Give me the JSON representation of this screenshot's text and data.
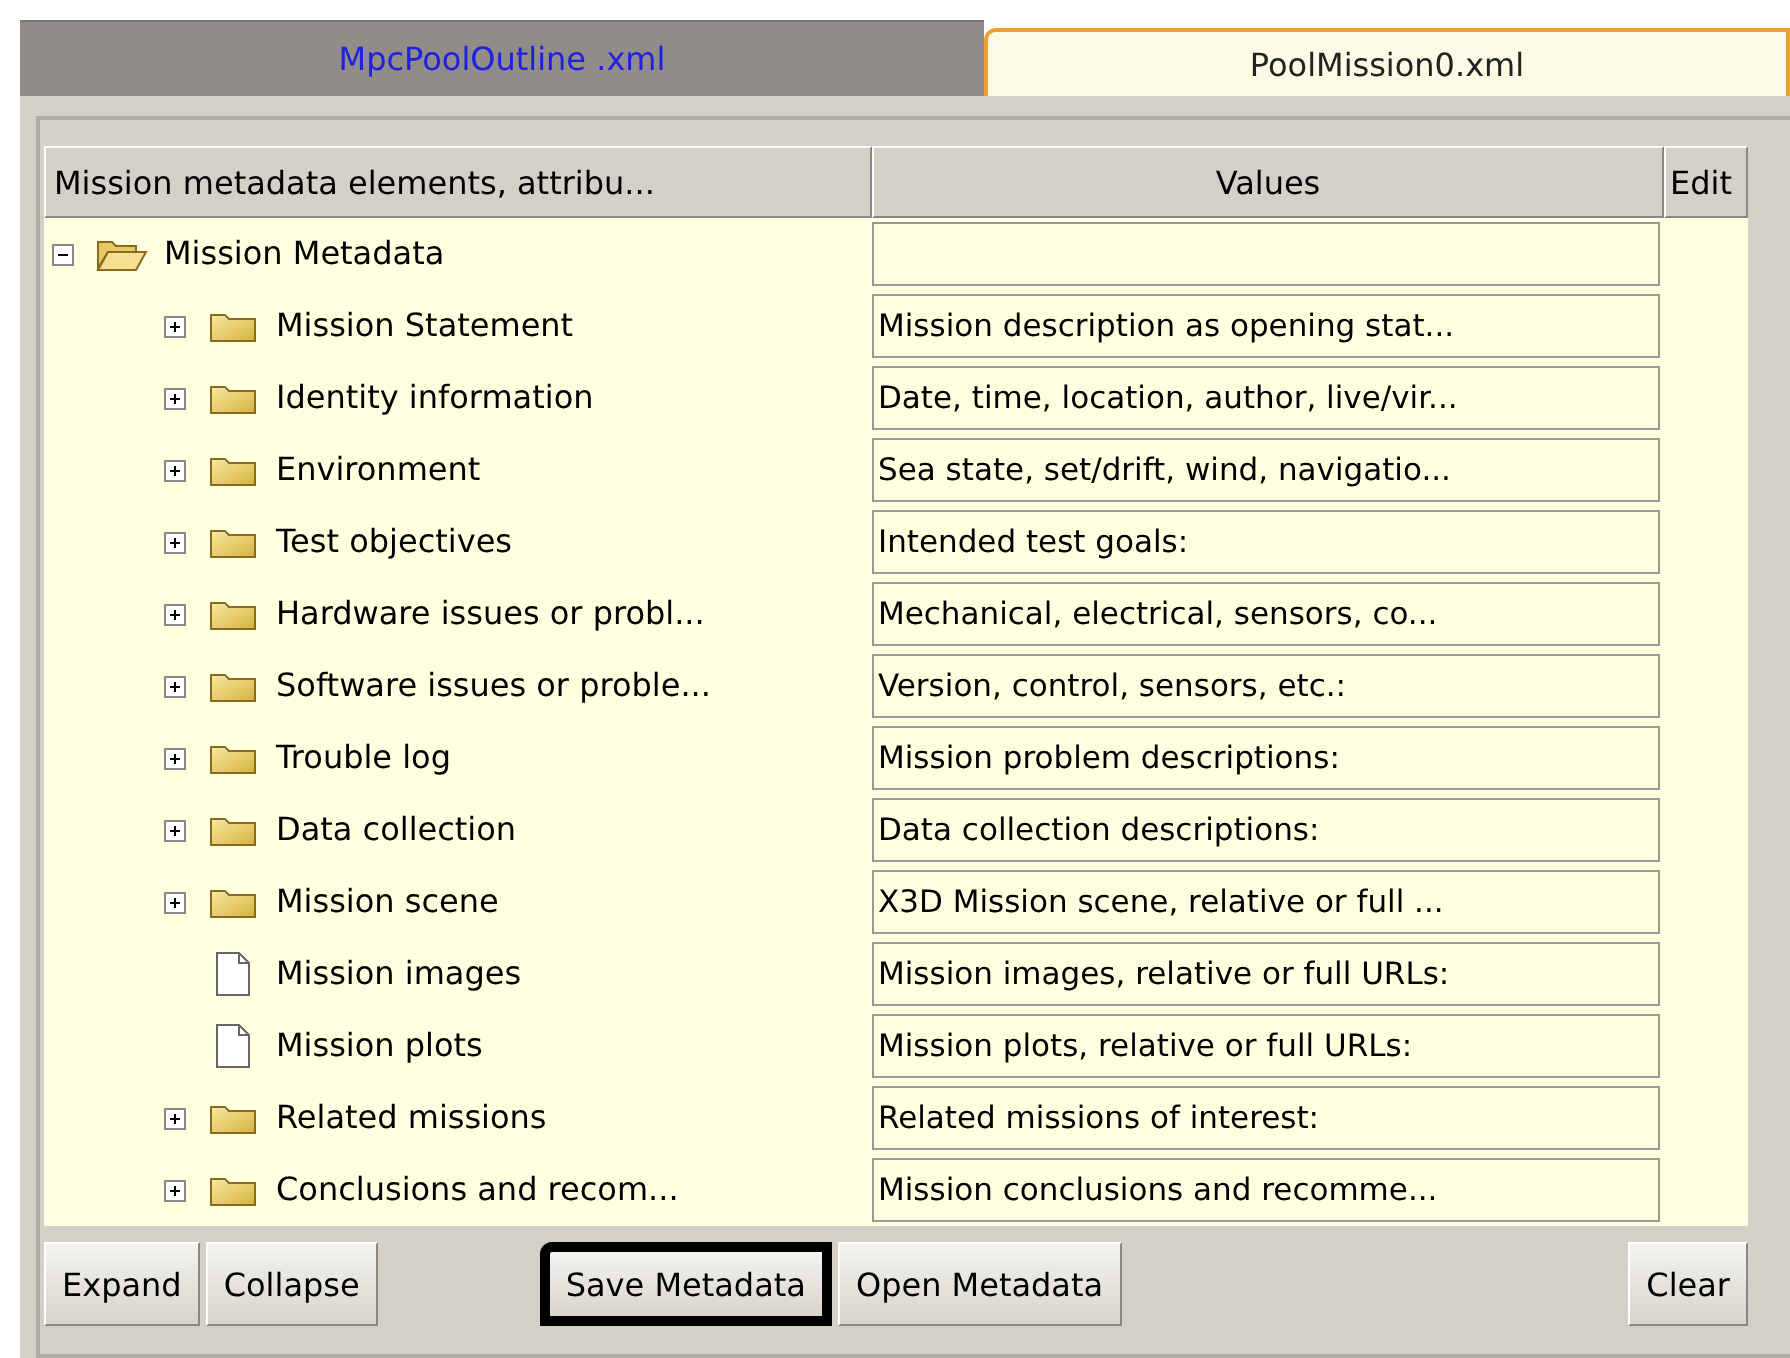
{
  "tabs": [
    {
      "label": "MpcPoolOutline .xml",
      "selected": false
    },
    {
      "label": "PoolMission0.xml",
      "selected": true
    }
  ],
  "table": {
    "columns": [
      "Mission metadata elements, attribu...",
      "Values",
      "Edit"
    ],
    "tree": {
      "label": "Mission Metadata",
      "expanded": true,
      "kind": "folder",
      "children": [
        {
          "label": "Mission Statement",
          "kind": "folder",
          "expanded": false,
          "value": "Mission description as opening stat..."
        },
        {
          "label": "Identity information",
          "kind": "folder",
          "expanded": false,
          "value": "Date, time, location, author, live/vir..."
        },
        {
          "label": "Environment",
          "kind": "folder",
          "expanded": false,
          "value": "Sea state, set/drift, wind, navigatio..."
        },
        {
          "label": "Test objectives",
          "kind": "folder",
          "expanded": false,
          "value": "Intended test goals:"
        },
        {
          "label": "Hardware issues or probl...",
          "kind": "folder",
          "expanded": false,
          "value": "Mechanical, electrical, sensors, co..."
        },
        {
          "label": "Software issues or proble...",
          "kind": "folder",
          "expanded": false,
          "value": "Version, control, sensors, etc.:"
        },
        {
          "label": "Trouble log",
          "kind": "folder",
          "expanded": false,
          "value": "Mission problem descriptions:"
        },
        {
          "label": "Data collection",
          "kind": "folder",
          "expanded": false,
          "value": "Data collection descriptions:"
        },
        {
          "label": "Mission scene",
          "kind": "folder",
          "expanded": false,
          "value": "X3D Mission scene, relative or full ..."
        },
        {
          "label": "Mission images",
          "kind": "file",
          "value": "Mission images, relative or full URLs:"
        },
        {
          "label": "Mission plots",
          "kind": "file",
          "value": "Mission plots, relative or full URLs:"
        },
        {
          "label": "Related missions",
          "kind": "folder",
          "expanded": false,
          "value": "Related missions of interest:"
        },
        {
          "label": "Conclusions and recom...",
          "kind": "folder",
          "expanded": false,
          "value": "Mission conclusions and recomme..."
        }
      ]
    }
  },
  "buttons": [
    {
      "label": "Expand",
      "highlighted": false
    },
    {
      "label": "Collapse",
      "highlighted": false
    },
    {
      "label": "Save Metadata",
      "highlighted": true
    },
    {
      "label": "Open Metadata",
      "highlighted": false
    },
    {
      "label": "Clear",
      "highlighted": false
    }
  ]
}
